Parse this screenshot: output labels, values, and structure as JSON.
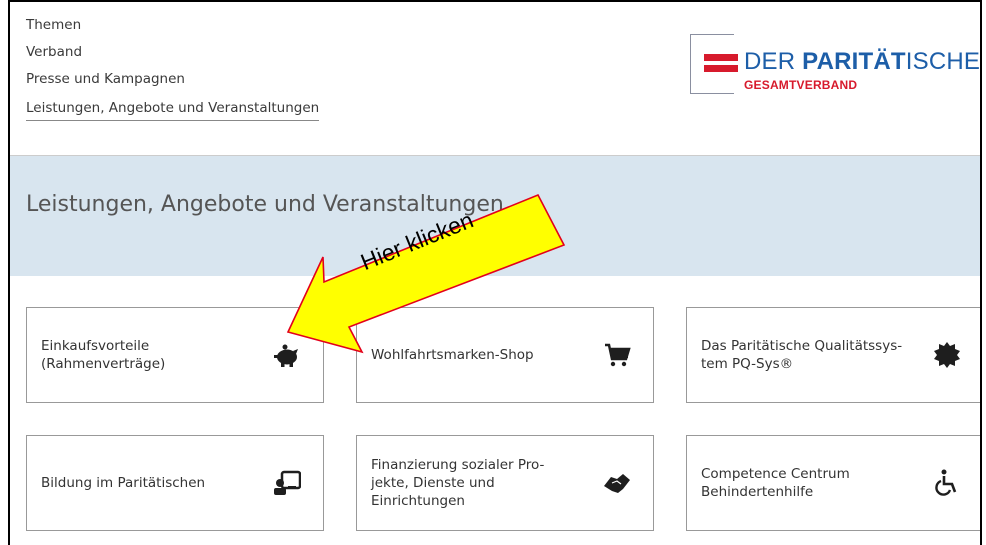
{
  "nav": {
    "items": [
      {
        "label": "Themen"
      },
      {
        "label": "Verband"
      },
      {
        "label": "Presse und Kampagnen"
      },
      {
        "label": "Leistungen, Angebote und Veranstaltungen"
      }
    ]
  },
  "logo": {
    "name_prefix": "DER ",
    "name_bold": "PARITÄT",
    "name_suffix": "ISCHE",
    "subtitle": "GESAMTVERBAND"
  },
  "page": {
    "heading": "Leistungen, Angebote und Veranstaltungen"
  },
  "tiles": [
    {
      "label": "Einkaufsvorteile (Rahmenverträge)",
      "icon": "piggy-bank-icon"
    },
    {
      "label": "Wohlfahrtsmarken-Shop",
      "icon": "shopping-cart-icon"
    },
    {
      "label": "Das Paritätische Qualitätssys-tem PQ-Sys®",
      "icon": "quality-seal-icon"
    },
    {
      "label": "Bildung im Paritätischen",
      "icon": "teacher-board-icon"
    },
    {
      "label": "Finanzierung sozialer Pro-jekte, Dienste und Einrichtungen",
      "icon": "handshake-icon"
    },
    {
      "label": "Competence Centrum Behindertenhilfe",
      "icon": "wheelchair-icon"
    }
  ],
  "annotation": {
    "text": "Hier klicken",
    "fill_color": "#ffff00",
    "stroke_color": "#e3001b"
  },
  "colors": {
    "brand_blue": "#1d5ea8",
    "brand_red": "#d71a2c",
    "band_bg": "#d8e5ef"
  }
}
